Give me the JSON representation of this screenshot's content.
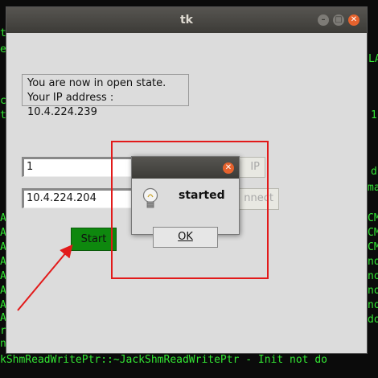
{
  "terminal": {
    "bottom_line": "kShmReadWritePtr::~JackShmReadWritePtr - Init not do",
    "right_fragments": [
      "LA",
      "1",
      "d",
      "ma",
      "CM",
      "CM",
      "CM",
      "no",
      "no",
      "no",
      "no",
      "do"
    ],
    "left_fragments": [
      "t",
      "e",
      "c",
      "t",
      "A",
      "A",
      "A",
      "A",
      "A",
      "A",
      "A",
      "A",
      "r",
      "n"
    ]
  },
  "window": {
    "title": "tk",
    "info_line1": "You are now in open state.",
    "info_line2": "Your IP address : 10.4.224.239",
    "entry1_value": "1",
    "entry2_value": "10.4.224.204",
    "ip_button_label": "IP",
    "connect_button_label": "nnect",
    "start_button_label": "Start"
  },
  "dialog": {
    "message": "started",
    "ok_label": "OK",
    "icon": "lightbulb-icon"
  },
  "colors": {
    "terminal_text": "#33e533",
    "start_button": "#0e880e",
    "annotation": "#e21a1a",
    "close_button": "#e6622d"
  }
}
